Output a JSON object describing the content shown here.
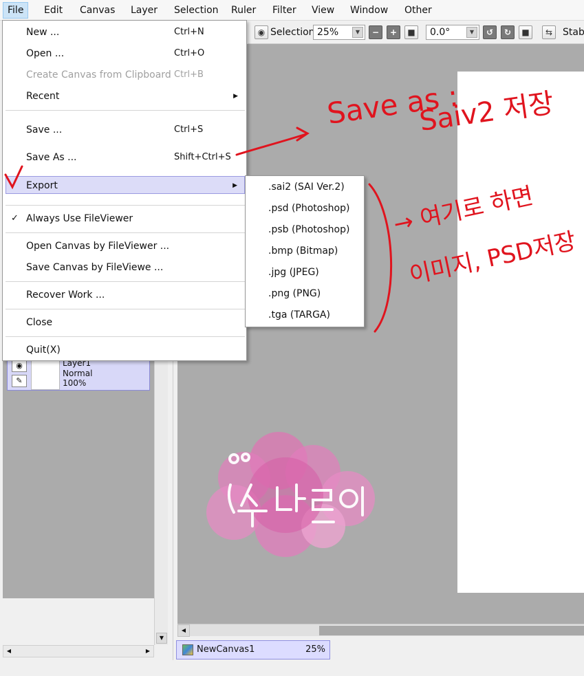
{
  "menubar": [
    "File",
    "Edit",
    "Canvas",
    "Layer",
    "Selection",
    "Ruler",
    "Filter",
    "View",
    "Window",
    "Other"
  ],
  "toolbar": {
    "selection_label": "Selection",
    "zoom": "25%",
    "angle": "0.0°",
    "stabilizer_label": "Stabi"
  },
  "file_menu": {
    "new": {
      "label": "New ...",
      "shortcut": "Ctrl+N"
    },
    "open": {
      "label": "Open ...",
      "shortcut": "Ctrl+O"
    },
    "create_from_clipboard": {
      "label": "Create Canvas from Clipboard",
      "shortcut": "Ctrl+B"
    },
    "recent": {
      "label": "Recent"
    },
    "save": {
      "label": "Save ...",
      "shortcut": "Ctrl+S"
    },
    "save_as": {
      "label": "Save As ...",
      "shortcut": "Shift+Ctrl+S"
    },
    "export": {
      "label": "Export"
    },
    "always_fileviewer": {
      "label": "Always Use FileViewer"
    },
    "open_by_fileviewer": {
      "label": "Open Canvas by FileViewer ..."
    },
    "save_by_fileviewer": {
      "label": "Save Canvas by FileViewe ..."
    },
    "recover": {
      "label": "Recover Work ..."
    },
    "close": {
      "label": "Close"
    },
    "quit": {
      "label": "Quit(X)"
    }
  },
  "export_menu": [
    ".sai2 (SAI Ver.2)",
    ".psd (Photoshop)",
    ".psb (Photoshop)",
    ".bmp (Bitmap)",
    ".jpg (JPEG)",
    ".png (PNG)",
    ".tga (TARGA)"
  ],
  "layer": {
    "name": "Layer1",
    "mode": "Normal",
    "opacity": "100%"
  },
  "canvas_tab": {
    "name": "NewCanvas1",
    "zoom": "25%"
  },
  "annotations": {
    "save_as_note_1": "Save as :",
    "save_as_note_2": "Saiv2 저장",
    "export_note_1": "→ 여기로 하면",
    "export_note_2": "이미지, PSD저장"
  },
  "colors": {
    "annotation": "#e0141e",
    "highlight": "#dcdcf8",
    "canvas_bg": "#ababab"
  }
}
